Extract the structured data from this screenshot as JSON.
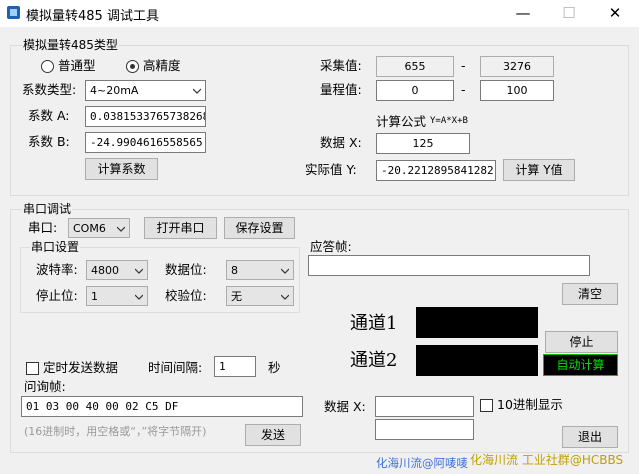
{
  "window": {
    "title": "模拟量转485 调试工具",
    "minimize": "—",
    "maximize": "☐",
    "close": "✕"
  },
  "analog_group": {
    "label": "模拟量转485类型",
    "radio_normal": "普通型",
    "radio_high": "高精度",
    "type_label": "系数类型:",
    "type_value": "4~20mA",
    "coef_a_label": "系数 A:",
    "coef_a_value": "0.0381533765738268",
    "coef_b_label": "系数 B:",
    "coef_b_value": "-24.9904616558565",
    "calc_coef_button": "计算系数",
    "sample_label": "采集值:",
    "sample_min": "655",
    "sample_sep": "-",
    "sample_max": "3276",
    "range_label": "量程值:",
    "range_min": "0",
    "range_sep": "-",
    "range_max": "100",
    "formula_label": "计算公式",
    "formula": "Y=A*X+B",
    "data_x_label": "数据 X:",
    "data_x_value": "125",
    "actual_y_label": "实际值 Y:",
    "actual_y_value": "-20.2212895841282",
    "calc_y_button": "计算 Y值"
  },
  "serial_group": {
    "label": "串口调试",
    "port_label": "串口:",
    "port_value": "COM6",
    "open_port_button": "打开串口",
    "save_settings_button": "保存设置",
    "settings_label": "串口设置",
    "baud_label": "波特率:",
    "baud_value": "4800",
    "databits_label": "数据位:",
    "databits_value": "8",
    "stopbits_label": "停止位:",
    "stopbits_value": "1",
    "parity_label": "校验位:",
    "parity_value": "无",
    "response_label": "应答帧:",
    "response_value": "",
    "clear_button": "清空",
    "channel1_label": "通道1",
    "channel2_label": "通道2",
    "stop_button": "停止",
    "auto_calc_button": "自动计算",
    "timed_send_label": "定时发送数据",
    "interval_label": "时间间隔:",
    "interval_value": "1",
    "interval_unit": "秒",
    "query_label": "问询帧:",
    "query_value": "01 03 00 40 00 02 C5 DF",
    "hint": "(16进制时，用空格或“，”将字节隔开)",
    "send_button": "发送",
    "data_x_label": "数据 X:",
    "data_x_value": "",
    "data_x_value2": "",
    "hex_display_label": "10进制显示",
    "exit_button": "退出"
  },
  "watermark": {
    "left": "化海川流@阿唛唛",
    "right": "化海川流 工业社群@HCBBS"
  }
}
